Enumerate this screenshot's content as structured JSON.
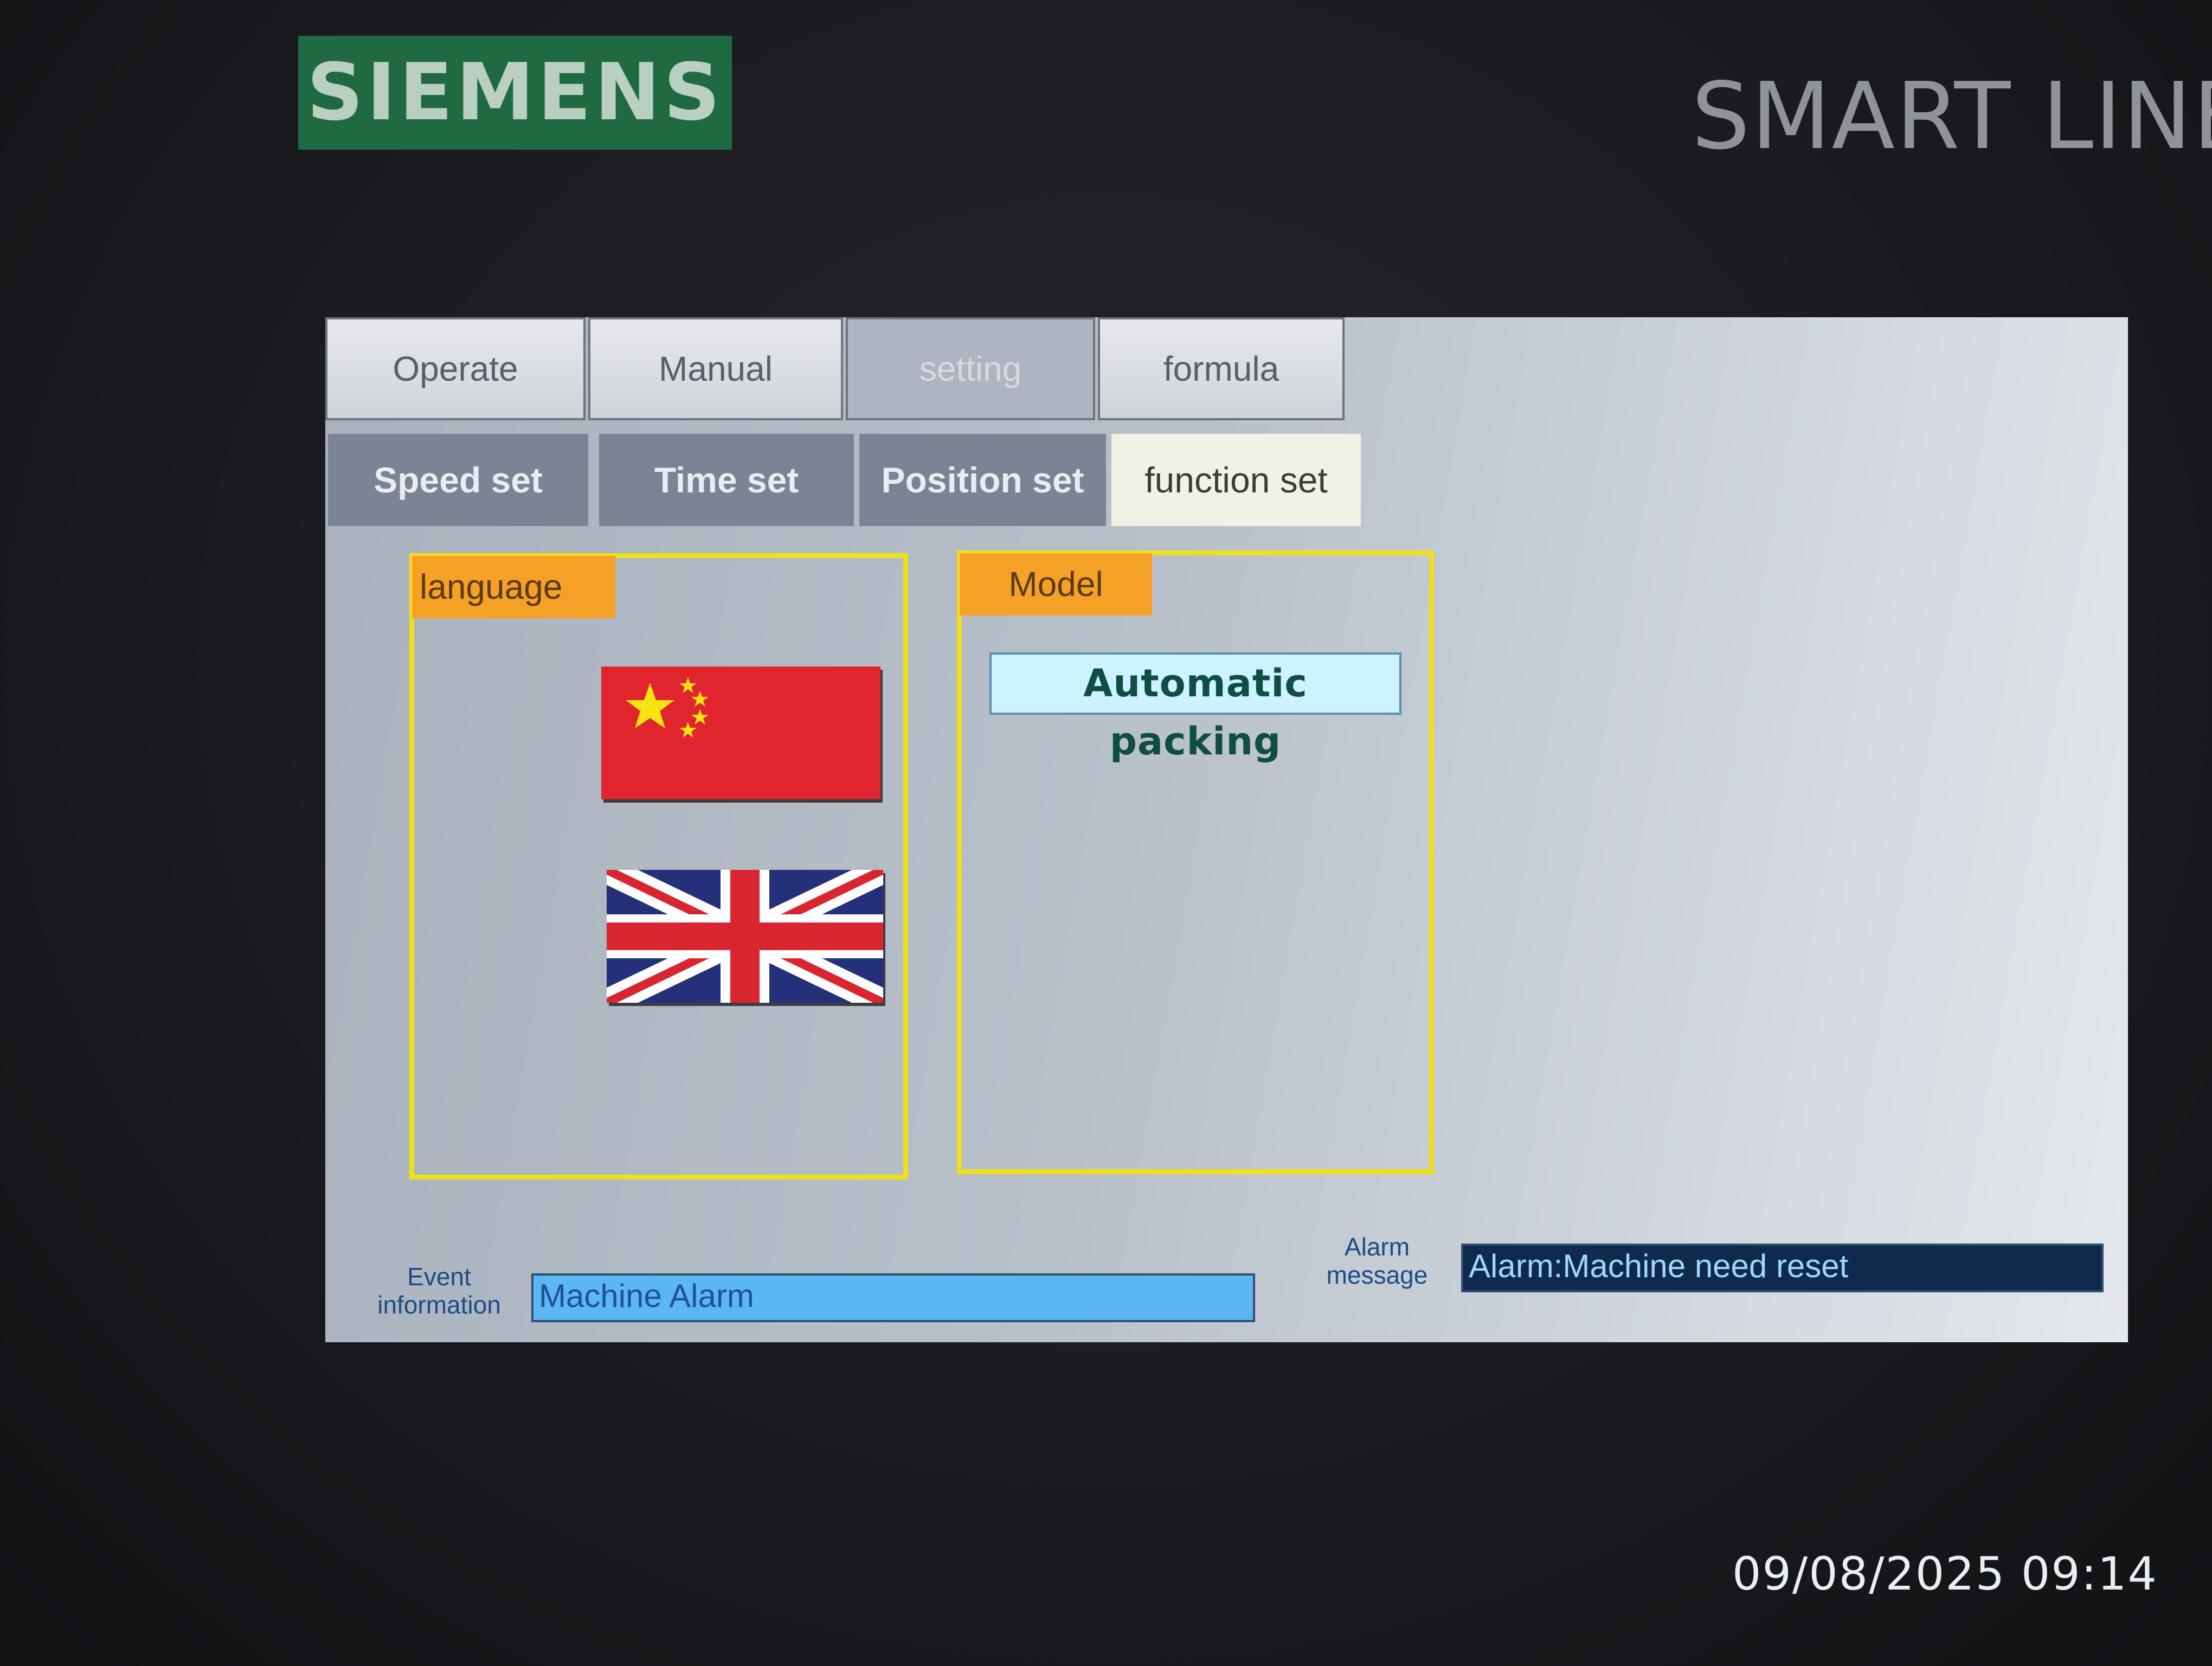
{
  "device": {
    "brand": "SIEMENS",
    "product": "SMART LINE"
  },
  "tabs": [
    {
      "label": "Operate",
      "active": false
    },
    {
      "label": "Manual",
      "active": false
    },
    {
      "label": "setting",
      "active": true
    },
    {
      "label": "formula",
      "active": false
    }
  ],
  "subtabs": [
    {
      "label": "Speed set",
      "active": false
    },
    {
      "label": "Time set",
      "active": false
    },
    {
      "label": "Position set",
      "active": false
    },
    {
      "label": "function  set",
      "active": true
    }
  ],
  "language": {
    "title": "language",
    "flags": [
      {
        "name": "china-flag-icon"
      },
      {
        "name": "uk-flag-icon"
      }
    ]
  },
  "model": {
    "title": "Model",
    "value": "Automatic packing"
  },
  "status": {
    "event_label_1": "Event",
    "event_label_2": "information",
    "event_value": "Machine Alarm",
    "alarm_label_1": "Alarm",
    "alarm_label_2": "message",
    "alarm_value": "Alarm:Machine need reset"
  },
  "photo_timestamp": "09/08/2025 09:14",
  "colors": {
    "group_border": "#f0e01a",
    "group_title_bg": "#f5a126",
    "subtab_bg": "#7a8494",
    "subtab_active_bg": "#f1f1e6",
    "brand_green": "#1f6a43"
  }
}
